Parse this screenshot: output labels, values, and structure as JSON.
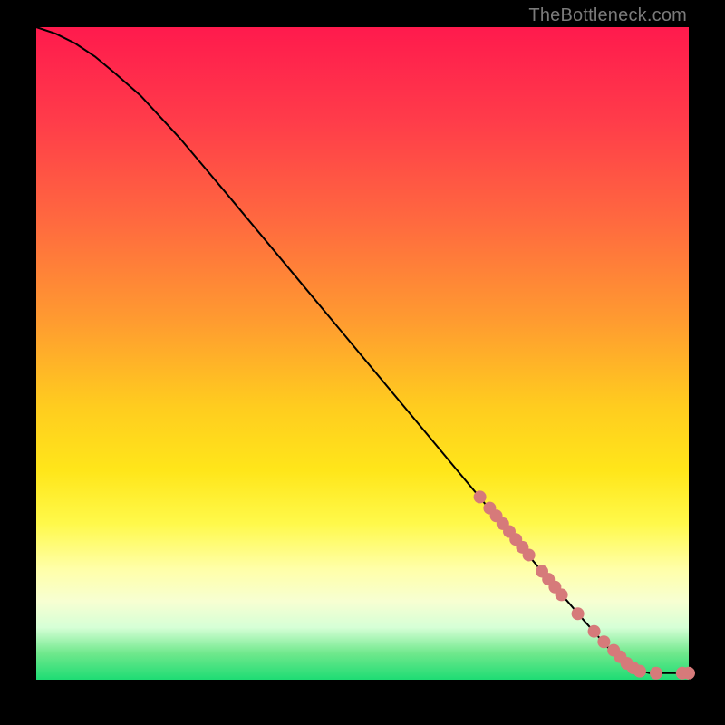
{
  "watermark": "TheBottleneck.com",
  "chart_data": {
    "type": "line",
    "title": "",
    "xlabel": "",
    "ylabel": "",
    "xlim": [
      0,
      100
    ],
    "ylim": [
      0,
      100
    ],
    "grid": false,
    "legend": false,
    "series": [
      {
        "name": "curve",
        "color": "#000000",
        "x": [
          0,
          3,
          6,
          9,
          12,
          16,
          22,
          30,
          40,
          50,
          60,
          70,
          78,
          84,
          88,
          90,
          92,
          94,
          96,
          98,
          100
        ],
        "y": [
          100,
          99,
          97.5,
          95.5,
          93,
          89.5,
          83,
          73.5,
          61.5,
          49.5,
          37.5,
          25.5,
          16,
          9,
          4.5,
          2.5,
          1.5,
          1,
          1,
          1,
          1
        ]
      }
    ],
    "points": {
      "name": "markers",
      "color": "#d67a7a",
      "radius_px": 7,
      "x": [
        68,
        69.5,
        70.5,
        71.5,
        72.5,
        73.5,
        74.5,
        75.5,
        77.5,
        78.5,
        79.5,
        80.5,
        83,
        85.5,
        87,
        88.5,
        89.5,
        90.5,
        91.5,
        92.5,
        95,
        99,
        100
      ],
      "y": [
        28,
        26.3,
        25.1,
        23.9,
        22.7,
        21.5,
        20.3,
        19.1,
        16.6,
        15.4,
        14.2,
        13,
        10.1,
        7.4,
        5.8,
        4.5,
        3.5,
        2.5,
        1.8,
        1.3,
        1,
        1,
        1
      ]
    }
  }
}
